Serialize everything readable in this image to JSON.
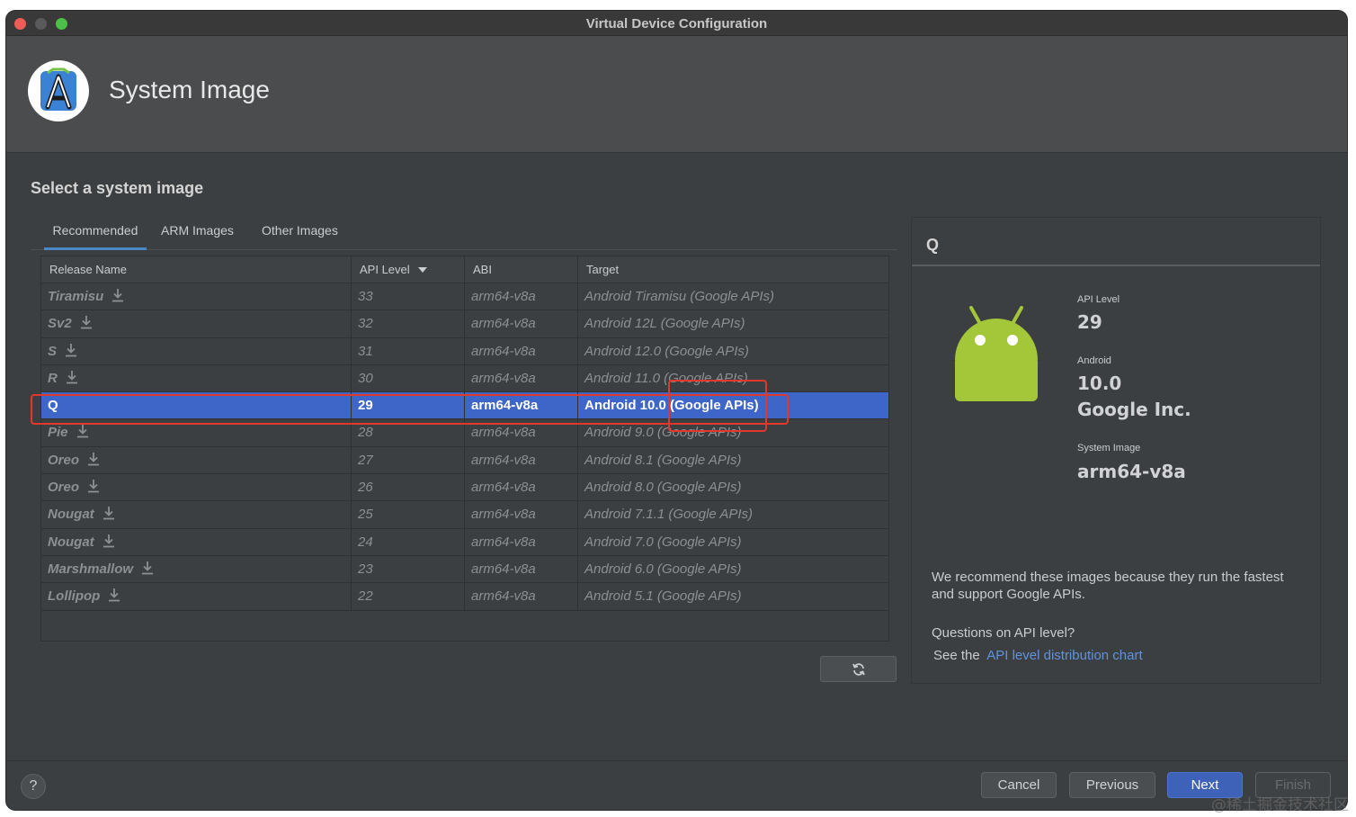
{
  "window": {
    "title": "Virtual Device Configuration"
  },
  "header": {
    "title": "System Image",
    "logo_icon": "android-studio-logo"
  },
  "section": {
    "title": "Select a system image"
  },
  "tabs": [
    {
      "label": "Recommended",
      "active": true
    },
    {
      "label": "ARM Images",
      "active": false
    },
    {
      "label": "Other Images",
      "active": false
    }
  ],
  "table": {
    "columns": [
      "Release Name",
      "API Level",
      "ABI",
      "Target"
    ],
    "sort_icon": "sort-down-icon",
    "rows": [
      {
        "name": "Tiramisu",
        "api": "33",
        "abi": "arm64-v8a",
        "target": "Android Tiramisu (Google APIs)",
        "download": true,
        "selected": false
      },
      {
        "name": "Sv2",
        "api": "32",
        "abi": "arm64-v8a",
        "target": "Android 12L (Google APIs)",
        "download": true,
        "selected": false
      },
      {
        "name": "S",
        "api": "31",
        "abi": "arm64-v8a",
        "target": "Android 12.0 (Google APIs)",
        "download": true,
        "selected": false
      },
      {
        "name": "R",
        "api": "30",
        "abi": "arm64-v8a",
        "target": "Android 11.0 (Google APIs)",
        "download": true,
        "selected": false
      },
      {
        "name": "Q",
        "api": "29",
        "abi": "arm64-v8a",
        "target": "Android 10.0 (Google APIs)",
        "download": false,
        "selected": true
      },
      {
        "name": "Pie",
        "api": "28",
        "abi": "arm64-v8a",
        "target": "Android 9.0 (Google APIs)",
        "download": true,
        "selected": false
      },
      {
        "name": "Oreo",
        "api": "27",
        "abi": "arm64-v8a",
        "target": "Android 8.1 (Google APIs)",
        "download": true,
        "selected": false
      },
      {
        "name": "Oreo",
        "api": "26",
        "abi": "arm64-v8a",
        "target": "Android 8.0 (Google APIs)",
        "download": true,
        "selected": false
      },
      {
        "name": "Nougat",
        "api": "25",
        "abi": "arm64-v8a",
        "target": "Android 7.1.1 (Google APIs)",
        "download": true,
        "selected": false
      },
      {
        "name": "Nougat",
        "api": "24",
        "abi": "arm64-v8a",
        "target": "Android 7.0 (Google APIs)",
        "download": true,
        "selected": false
      },
      {
        "name": "Marshmallow",
        "api": "23",
        "abi": "arm64-v8a",
        "target": "Android 6.0 (Google APIs)",
        "download": true,
        "selected": false
      },
      {
        "name": "Lollipop",
        "api": "22",
        "abi": "arm64-v8a",
        "target": "Android 5.1 (Google APIs)",
        "download": true,
        "selected": false
      }
    ]
  },
  "refresh_icon": "refresh-icon",
  "detail": {
    "title": "Q",
    "api_label": "API Level",
    "api_value": "29",
    "android_label": "Android",
    "android_value": "10.0",
    "vendor": "Google Inc.",
    "system_image_label": "System Image",
    "system_image_value": "arm64-v8a",
    "recommend_text": "We recommend these images because they run the fastest and support Google APIs.",
    "question": "Questions on API level?",
    "see_the": "See the",
    "link_text": "API level distribution chart"
  },
  "footer": {
    "help": "?",
    "cancel": "Cancel",
    "previous": "Previous",
    "next": "Next",
    "finish": "Finish"
  },
  "watermark": "@稀土掘金技术社区",
  "colors": {
    "selection": "#3e66c8",
    "annotation": "#e0392b",
    "link": "#5d94e0"
  }
}
